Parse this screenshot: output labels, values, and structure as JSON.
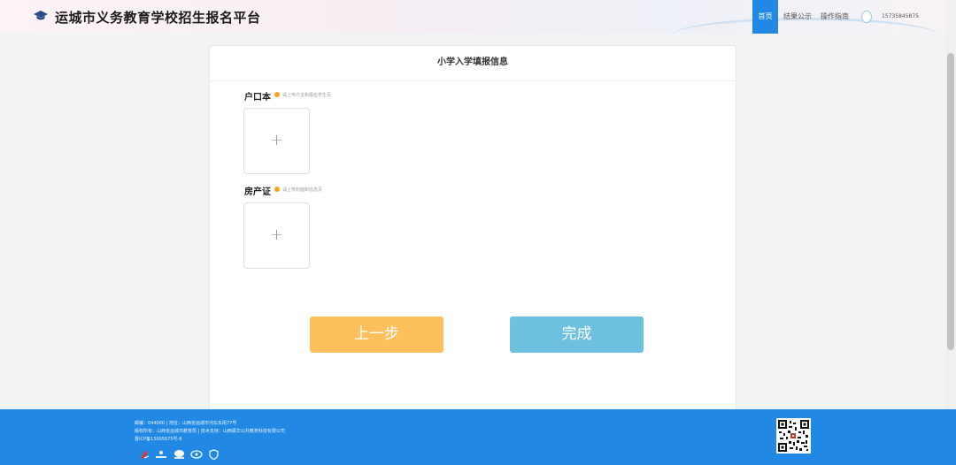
{
  "header": {
    "title": "运城市义务教育学校招生报名平台",
    "nav": [
      {
        "label": "首页",
        "active": true
      },
      {
        "label": "结果公示",
        "active": false
      },
      {
        "label": "操作指南",
        "active": false
      }
    ],
    "user_phone": "15735845875",
    "user_menu_icon": "chevron-down-icon"
  },
  "card": {
    "title": "小学入学填报信息",
    "fields": [
      {
        "label": "户口本",
        "hint": "请上传户主和报名学生页",
        "icon": "plus-icon"
      },
      {
        "label": "房产证",
        "hint": "请上传封面和信息页",
        "icon": "plus-icon"
      }
    ],
    "buttons": {
      "prev": "上一步",
      "done": "完成"
    }
  },
  "footer": {
    "line1": "邮编：044000 | 地址：山西省运城市河东东街77号",
    "line2": "版权所有：山西省运城市教育局 | 技术支持：山西振华公共教育科技有限公司",
    "line3": "晋ICP备13005675号-8"
  },
  "colors": {
    "primary": "#2189e4",
    "prev_button": "#fec05c",
    "done_button": "#6ec0e0",
    "hint_dot": "#f5a623"
  }
}
